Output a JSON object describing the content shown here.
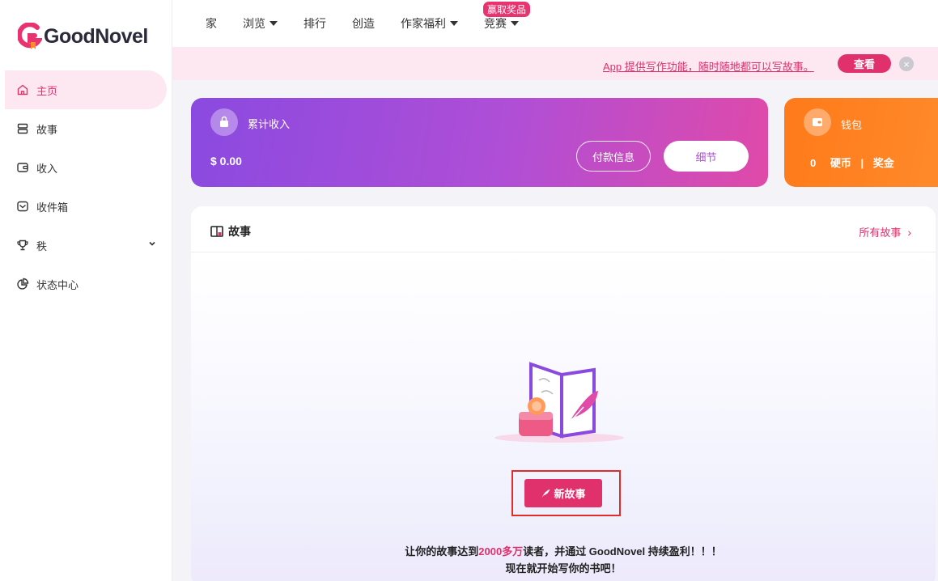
{
  "brand": {
    "name": "GoodNovel"
  },
  "sidebar": {
    "items": [
      {
        "label": "主页",
        "icon": "home-icon",
        "active": true
      },
      {
        "label": "故事",
        "icon": "stories-icon"
      },
      {
        "label": "收入",
        "icon": "income-icon"
      },
      {
        "label": "收件箱",
        "icon": "inbox-icon"
      },
      {
        "label": "秩",
        "icon": "rank-icon"
      },
      {
        "label": "状态中心",
        "icon": "stats-icon"
      }
    ]
  },
  "topnav": {
    "items": [
      {
        "label": "家"
      },
      {
        "label": "浏览",
        "dropdown": true
      },
      {
        "label": "排行"
      },
      {
        "label": "创造"
      },
      {
        "label": "作家福利",
        "dropdown": true
      },
      {
        "label": "竞赛",
        "dropdown": true,
        "badge": "赢取奖品"
      }
    ]
  },
  "notice": {
    "text": "App 提供写作功能，随时随地都可以写故事。",
    "button": "查看"
  },
  "income": {
    "title": "累计收入",
    "amount": "$ 0.00",
    "payment_button": "付款信息",
    "details_button": "细节"
  },
  "wallet": {
    "title": "钱包",
    "coins": "0",
    "coins_label": "硬币",
    "separator": "|",
    "bonus_label": "奖金"
  },
  "stories": {
    "title": "故事",
    "all_link": "所有故事",
    "new_button": "新故事",
    "promo_prefix": "让你的故事达到",
    "promo_highlight": "2000多万",
    "promo_suffix": "读者，并通过 GoodNovel 持续盈利！！！",
    "promo_line2": "现在就开始写你的书吧！"
  },
  "colors": {
    "accent": "#e0316d",
    "income_gradient_start": "#8a4ae0",
    "income_gradient_end": "#e04aa8",
    "wallet": "#ff7a1a"
  }
}
